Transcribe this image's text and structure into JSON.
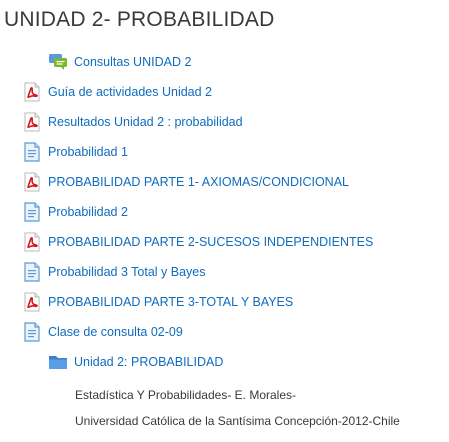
{
  "section": {
    "title": "UNIDAD 2- PROBABILIDAD"
  },
  "activities": [
    {
      "label": "Consultas UNIDAD 2",
      "icon": "forum-icon"
    },
    {
      "label": "Guía de actividades Unidad 2",
      "icon": "pdf-icon"
    },
    {
      "label": "Resultados Unidad 2 : probabilidad",
      "icon": "pdf-icon"
    },
    {
      "label": "Probabilidad 1",
      "icon": "document-icon"
    },
    {
      "label": "PROBABILIDAD PARTE 1- AXIOMAS/CONDICIONAL",
      "icon": "pdf-icon"
    },
    {
      "label": "Probabilidad 2",
      "icon": "document-icon"
    },
    {
      "label": "PROBABILIDAD PARTE 2-SUCESOS INDEPENDIENTES",
      "icon": "pdf-icon"
    },
    {
      "label": "Probabilidad 3 Total y Bayes",
      "icon": "document-icon"
    },
    {
      "label": "PROBABILIDAD PARTE 3-TOTAL Y BAYES",
      "icon": "pdf-icon"
    },
    {
      "label": "Clase de consulta 02-09",
      "icon": "document-icon"
    },
    {
      "label": "Unidad 2: PROBABILIDAD",
      "icon": "folder-icon"
    }
  ],
  "description": {
    "line1": "Estadística Y Probabilidades- E. Morales-",
    "line2": "Universidad Católica de la Santísima Concepción-2012-Chile"
  },
  "colors": {
    "link": "#0f6cbf",
    "text": "#373a3c",
    "pdf_red": "#d7141a",
    "forum_green": "#7cb82f",
    "document_blue": "#5b9bd5",
    "folder_blue": "#4a90d9"
  }
}
